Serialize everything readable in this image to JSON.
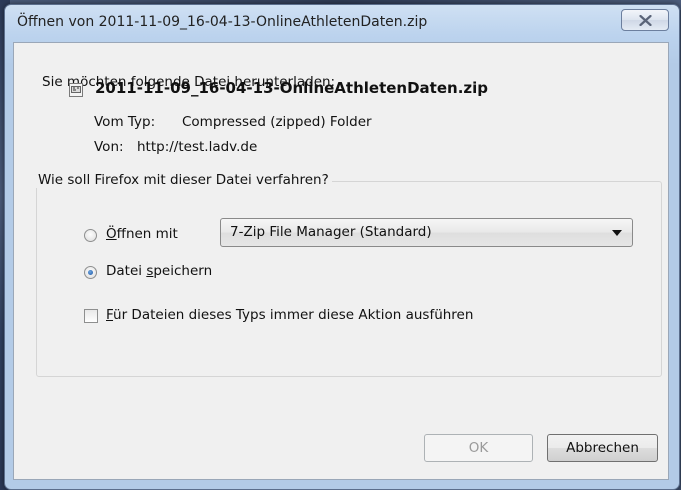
{
  "window": {
    "title": "Öffnen von 2011-11-09_16-04-13-OnlineAthletenDaten.zip"
  },
  "dialog": {
    "intro": "Sie möchten folgende Datei herunterladen:",
    "file_icon": "zip-file-icon",
    "filename": "2011-11-09_16-04-13-OnlineAthletenDaten.zip",
    "type_label": "Vom Typ:",
    "type_value": "Compressed (zipped) Folder",
    "source_label": "Von:",
    "source_value": "http://test.ladv.de"
  },
  "action_group": {
    "legend": "Wie soll Firefox mit dieser Datei verfahren?",
    "open_with": {
      "mnemonic": "Ö",
      "rest": "ffnen mit",
      "selected": false
    },
    "open_with_app": "7-Zip File Manager (Standard)",
    "save_file": {
      "pre": "Datei ",
      "mnemonic": "s",
      "rest": "peichern",
      "selected": true
    },
    "always_do": {
      "mnemonic": "F",
      "rest": "ür Dateien dieses Typs immer diese Aktion ausführen",
      "checked": false
    }
  },
  "buttons": {
    "ok": "OK",
    "cancel": "Abbrechen"
  }
}
